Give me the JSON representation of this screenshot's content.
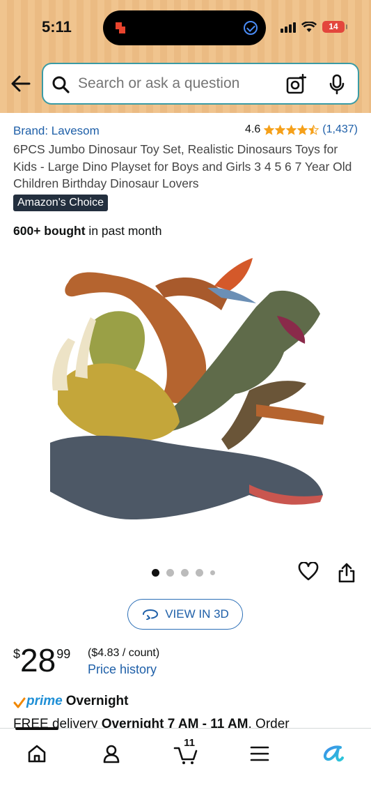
{
  "status_bar": {
    "time": "5:11",
    "battery": "14"
  },
  "search": {
    "placeholder": "Search or ask a question"
  },
  "product": {
    "brand": "Brand: Lavesom",
    "rating": "4.6",
    "rating_count": "(1,437)",
    "stars_filled": 4.5,
    "title": "6PCS Jumbo Dinosaur Toy Set, Realistic Dinosaurs Toys for Kids - Large Dino Playset for Boys and Girls 3 4 5 6 7 Year Old Children Birthday Dinosaur Lovers",
    "badge": "Amazon's Choice",
    "bought_bold": "600+ bought",
    "bought_rest": " in past month",
    "image_count": 5,
    "active_image": 1
  },
  "view3d": {
    "label": "VIEW IN 3D"
  },
  "price": {
    "symbol": "$",
    "whole": "28",
    "fraction": "99",
    "unit": "($4.83 / count)",
    "history_link": "Price history"
  },
  "delivery": {
    "prime": "prime",
    "speed": "Overnight",
    "free_label": "FREE delivery",
    "window": "Overnight 7 AM - 11 AM",
    "rest": ". Order"
  },
  "bottom_nav": {
    "cart_count": "11",
    "items": [
      "home-icon",
      "account-icon",
      "cart-icon",
      "menu-icon",
      "rufus-icon"
    ]
  },
  "colors": {
    "header_bg": "#f0c48e",
    "link": "#1e5fa8",
    "star": "#f5a01a",
    "badge_bg": "#232f3e",
    "prime": "#1e8fd6",
    "prime_check": "#f08804"
  }
}
